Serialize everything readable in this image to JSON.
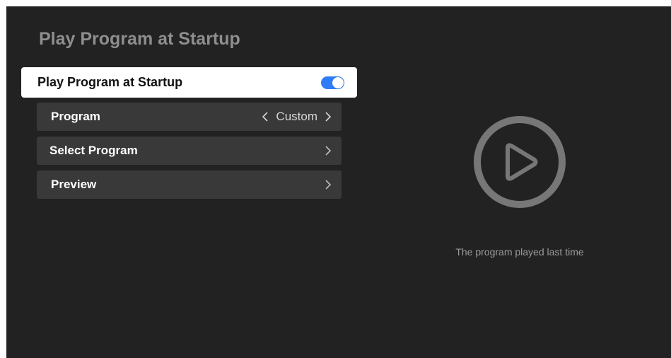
{
  "page": {
    "title": "Play Program at Startup"
  },
  "settings": {
    "startup_toggle": {
      "label": "Play Program at Startup",
      "state": "on",
      "accent_color": "#2f7df6"
    },
    "program": {
      "label": "Program",
      "value": "Custom",
      "left_icon": "chevron-left-icon",
      "right_icon": "chevron-right-icon"
    },
    "select_program": {
      "label": "Select Program",
      "icon": "chevron-right-icon"
    },
    "preview": {
      "label": "Preview",
      "icon": "chevron-right-icon"
    }
  },
  "preview_panel": {
    "icon": "play-circle-icon",
    "caption": "The program played last time"
  }
}
